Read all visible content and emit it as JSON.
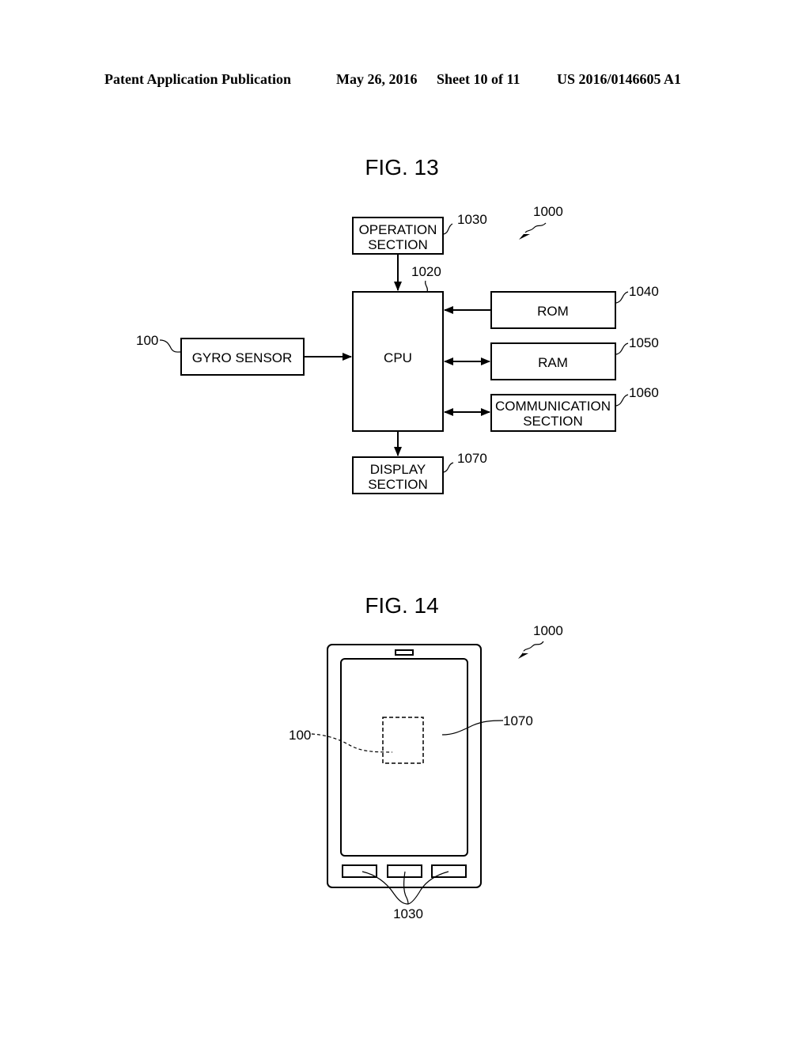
{
  "header": {
    "publication": "Patent Application Publication",
    "date": "May 26, 2016",
    "sheet": "Sheet 10 of 11",
    "number": "US 2016/0146605 A1"
  },
  "fig13": {
    "title": "FIG. 13",
    "device_ref": "1000",
    "blocks": {
      "operation": {
        "line1": "OPERATION",
        "line2": "SECTION",
        "ref": "1030"
      },
      "cpu": {
        "label": "CPU",
        "ref": "1020"
      },
      "gyro": {
        "label": "GYRO SENSOR",
        "ref": "100"
      },
      "rom": {
        "label": "ROM",
        "ref": "1040"
      },
      "ram": {
        "label": "RAM",
        "ref": "1050"
      },
      "comm": {
        "line1": "COMMUNICATION",
        "line2": "SECTION",
        "ref": "1060"
      },
      "display": {
        "line1": "DISPLAY",
        "line2": "SECTION",
        "ref": "1070"
      }
    }
  },
  "fig14": {
    "title": "FIG. 14",
    "device_ref": "1000",
    "sensor_ref": "100",
    "display_ref": "1070",
    "buttons_ref": "1030"
  }
}
